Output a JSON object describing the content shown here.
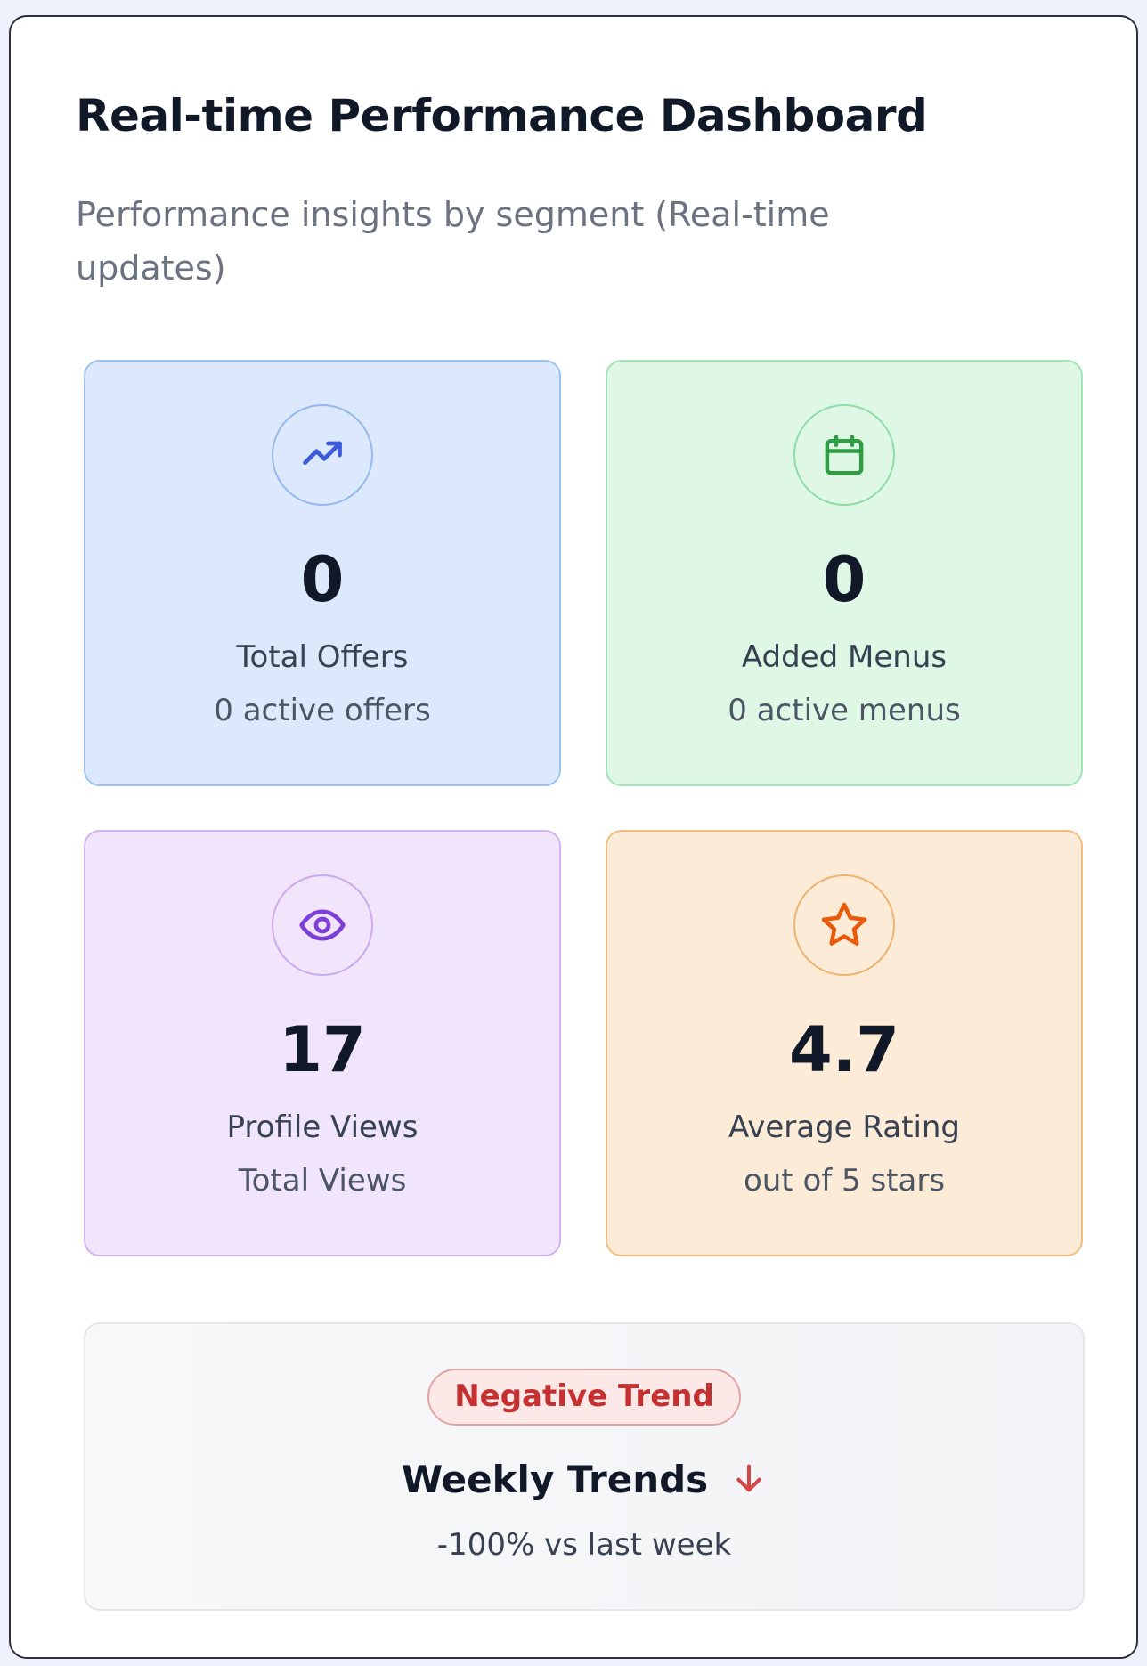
{
  "header": {
    "title": "Real-time Performance Dashboard",
    "subtitle": "Performance insights by segment (Real-time updates)"
  },
  "cards": [
    {
      "icon": "trending-up-icon",
      "value": "0",
      "label": "Total Offers",
      "sub": "0 active offers",
      "accent": "#3b5bdb"
    },
    {
      "icon": "calendar-icon",
      "value": "0",
      "label": "Added Menus",
      "sub": "0 active menus",
      "accent": "#2f9e44"
    },
    {
      "icon": "eye-icon",
      "value": "17",
      "label": "Profile Views",
      "sub": "Total Views",
      "accent": "#7e3fd6"
    },
    {
      "icon": "star-icon",
      "value": "4.7",
      "label": "Average Rating",
      "sub": "out of 5 stars",
      "accent": "#e8590c"
    }
  ],
  "trend": {
    "badge": "Negative Trend",
    "title": "Weekly Trends",
    "icon": "arrow-down-icon",
    "sub": "-100% vs last week",
    "accent": "#d64545"
  }
}
